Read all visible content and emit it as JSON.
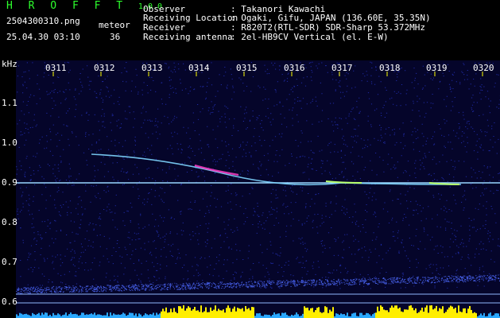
{
  "header": {
    "app_name": "H R O F F T",
    "version": "1.0.0",
    "filename": "2504300310.png",
    "meteor_label": "meteor",
    "date_time": "25.04.30 03:10",
    "meteor_count": "36",
    "meta": [
      {
        "label": "Observer",
        "value": ": Takanori Kawachi"
      },
      {
        "label": "Receiving Location",
        "value": ": Ogaki, Gifu, JAPAN (136.60E, 35.35N)"
      },
      {
        "label": "Receiver",
        "value": ": R820T2(RTL-SDR) SDR-Sharp 53.372MHz"
      },
      {
        "label": "Receiving antenna",
        "value": ": 2el-HB9CV Vertical (el. E-W)"
      }
    ]
  },
  "spectrogram": {
    "y_unit": "kHz",
    "y_ticks": [
      "1.1",
      "1.0",
      "0.9",
      "0.8",
      "0.7",
      "0.6"
    ],
    "x_ticks": [
      "0311",
      "0312",
      "0313",
      "0314",
      "0315",
      "0316",
      "0317",
      "0318",
      "0319",
      "0320"
    ],
    "colors": {
      "background": "#05052a",
      "carrier": "#9ad7ff",
      "trail": "#7fd6ff",
      "hot": "#ff3fc8",
      "bar": "#ffee00",
      "axis_tick": "#ffff00"
    }
  }
}
